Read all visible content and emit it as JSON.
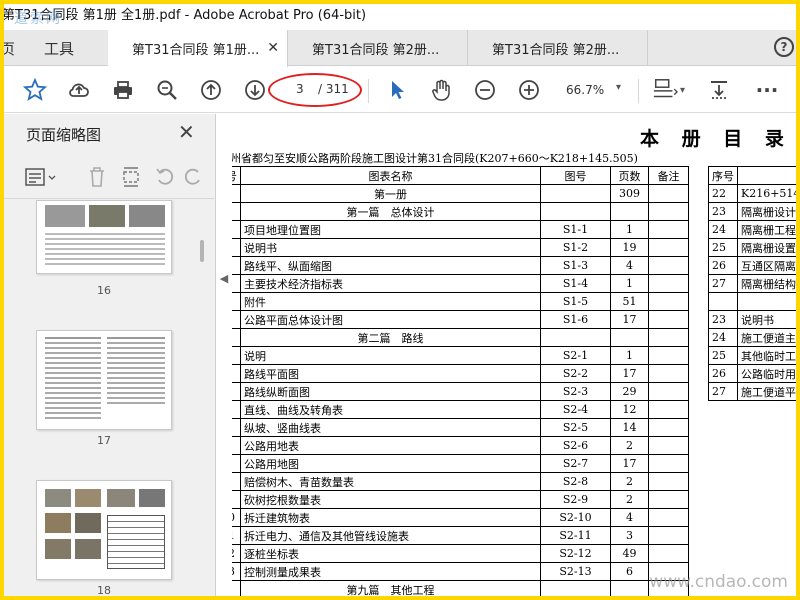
{
  "window": {
    "title": "第T31合同段 第1册 全1册.pdf - Adobe Acrobat Pro (64-bit)",
    "watermark": "道索网"
  },
  "nav": {
    "home": "页",
    "tools": "工具"
  },
  "tabs": [
    {
      "label": "第T31合同段 第1册..."
    },
    {
      "label": "第T31合同段 第2册..."
    },
    {
      "label": "第T31合同段 第2册..."
    }
  ],
  "toolbar": {
    "page_current": "3",
    "page_total": "/ 311",
    "zoom": "66.7%"
  },
  "panel": {
    "title": "页面缩略图",
    "thumbs": [
      "16",
      "17",
      "18"
    ]
  },
  "doc": {
    "heading": "本 册 目 录",
    "subtitle": "州省都匀至安顺公路两阶段施工图设计第31合同段(K207+660～K218+145.505)",
    "headers": {
      "no": "号",
      "name": "图表名称",
      "code": "图号",
      "pages": "页数",
      "note": "备注"
    },
    "rows": [
      {
        "no": "",
        "name": "第一册",
        "code": "",
        "pages": "309",
        "section": true
      },
      {
        "no": "",
        "name": "第一篇　总体设计",
        "code": "",
        "pages": "",
        "section": true
      },
      {
        "no": "",
        "name": "项目地理位置图",
        "code": "S1-1",
        "pages": "1"
      },
      {
        "no": "",
        "name": "说明书",
        "code": "S1-2",
        "pages": "19"
      },
      {
        "no": "",
        "name": "路线平、纵面缩图",
        "code": "S1-3",
        "pages": "4"
      },
      {
        "no": "",
        "name": "主要技术经济指标表",
        "code": "S1-4",
        "pages": "1"
      },
      {
        "no": "",
        "name": "附件",
        "code": "S1-5",
        "pages": "51"
      },
      {
        "no": "",
        "name": "公路平面总体设计图",
        "code": "S1-6",
        "pages": "17"
      },
      {
        "no": "",
        "name": "第二篇　路线",
        "code": "",
        "pages": "",
        "section": true
      },
      {
        "no": "",
        "name": "说明",
        "code": "S2-1",
        "pages": "1"
      },
      {
        "no": "",
        "name": "路线平面图",
        "code": "S2-2",
        "pages": "17"
      },
      {
        "no": "",
        "name": "路线纵断面图",
        "code": "S2-3",
        "pages": "29"
      },
      {
        "no": "",
        "name": "直线、曲线及转角表",
        "code": "S2-4",
        "pages": "12"
      },
      {
        "no": "",
        "name": "纵坡、竖曲线表",
        "code": "S2-5",
        "pages": "14"
      },
      {
        "no": "",
        "name": "公路用地表",
        "code": "S2-6",
        "pages": "2"
      },
      {
        "no": "",
        "name": "公路用地图",
        "code": "S2-7",
        "pages": "17"
      },
      {
        "no": "",
        "name": "赔偿树木、青苗数量表",
        "code": "S2-8",
        "pages": "2"
      },
      {
        "no": "",
        "name": "砍树挖根数量表",
        "code": "S2-9",
        "pages": "2"
      },
      {
        "no": "0",
        "name": "拆迁建筑物表",
        "code": "S2-10",
        "pages": "4"
      },
      {
        "no": "1",
        "name": "拆迁电力、通信及其他管线设施表",
        "code": "S2-11",
        "pages": "3"
      },
      {
        "no": "2",
        "name": "逐桩坐标表",
        "code": "S2-12",
        "pages": "49"
      },
      {
        "no": "3",
        "name": "控制测量成果表",
        "code": "S2-13",
        "pages": "6"
      },
      {
        "no": "",
        "name": "第九篇　其他工程",
        "code": "",
        "pages": "",
        "section": true
      }
    ],
    "right_header": "序号",
    "right_rows": [
      {
        "no": "22",
        "text": "K216+514"
      },
      {
        "no": "23",
        "text": "隔离栅设计"
      },
      {
        "no": "24",
        "text": "隔离栅工程"
      },
      {
        "no": "25",
        "text": "隔离栅设置"
      },
      {
        "no": "26",
        "text": "互通区隔离"
      },
      {
        "no": "27",
        "text": "隔离栅结构"
      },
      {
        "no": "",
        "text": ""
      },
      {
        "no": "23",
        "text": "说明书"
      },
      {
        "no": "24",
        "text": "施工便道主"
      },
      {
        "no": "25",
        "text": "其他临时工"
      },
      {
        "no": "26",
        "text": "公路临时用"
      },
      {
        "no": "27",
        "text": "施工便道平"
      }
    ],
    "watermark": "www.cndao.com"
  }
}
